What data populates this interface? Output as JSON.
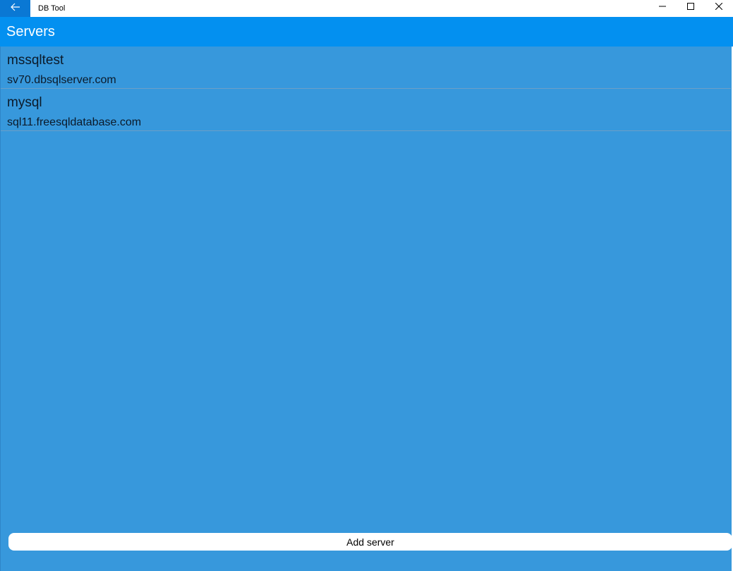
{
  "window": {
    "title": "DB Tool"
  },
  "header": {
    "title": "Servers"
  },
  "servers": [
    {
      "name": "mssqltest",
      "host": "sv70.dbsqlserver.com"
    },
    {
      "name": "mysql",
      "host": "sql11.freesqldatabase.com"
    }
  ],
  "actions": {
    "add_server_label": "Add server"
  },
  "icons": {
    "back": "arrow-left-icon",
    "minimize": "minimize-icon",
    "maximize": "maximize-icon",
    "close": "close-icon"
  },
  "colors": {
    "accent": "#0390f0",
    "back_button": "#0a78d4",
    "content_bg": "#3798dc",
    "button_bg": "#ffffff"
  }
}
